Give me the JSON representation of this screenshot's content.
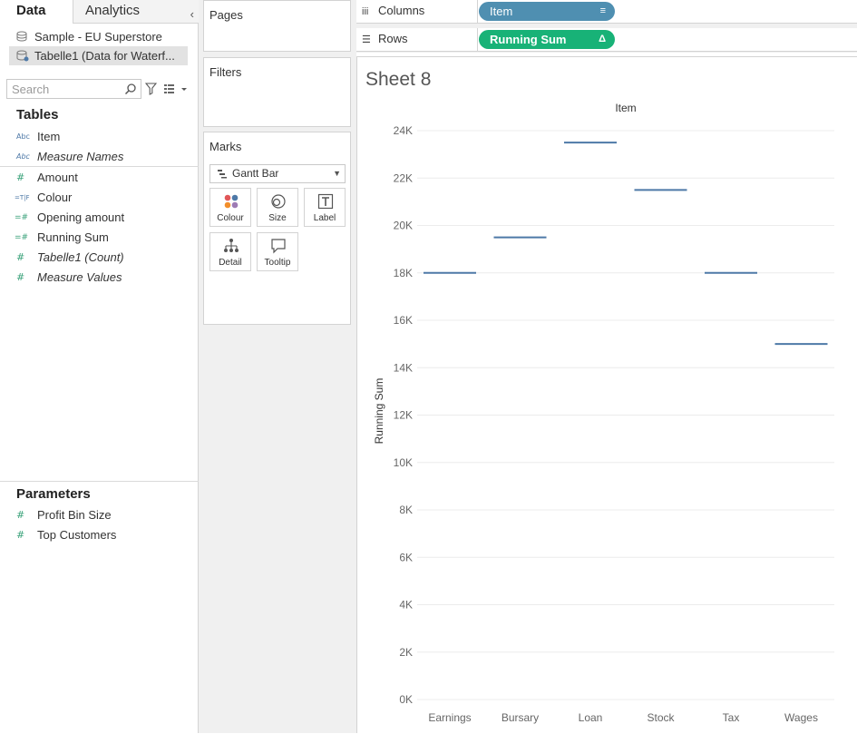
{
  "tabs": {
    "data_label": "Data",
    "analytics_label": "Analytics"
  },
  "data_sources": [
    {
      "label": "Sample - EU Superstore",
      "selected": false
    },
    {
      "label": "Tabelle1 (Data for Waterf...",
      "selected": true
    }
  ],
  "search": {
    "placeholder": "Search"
  },
  "tables_title": "Tables",
  "fields": [
    {
      "label": "Item",
      "icon": "Abc",
      "type": "dimension-string",
      "italic": false
    },
    {
      "label": "Measure Names",
      "icon": "Abc",
      "type": "dimension-string",
      "italic": true
    },
    {
      "label": "Amount",
      "icon": "#",
      "type": "measure",
      "italic": false
    },
    {
      "label": "Colour",
      "icon": "=T|F",
      "type": "calculated-boolean",
      "italic": false
    },
    {
      "label": "Opening amount",
      "icon": "=#",
      "type": "calculated-measure",
      "italic": false
    },
    {
      "label": "Running Sum",
      "icon": "=#",
      "type": "calculated-measure",
      "italic": false
    },
    {
      "label": "Tabelle1 (Count)",
      "icon": "#",
      "type": "measure",
      "italic": true
    },
    {
      "label": "Measure Values",
      "icon": "#",
      "type": "measure",
      "italic": true
    }
  ],
  "parameters_title": "Parameters",
  "parameters": [
    {
      "label": "Profit Bin Size",
      "icon": "#"
    },
    {
      "label": "Top Customers",
      "icon": "#"
    }
  ],
  "cards": {
    "pages": "Pages",
    "filters": "Filters",
    "marks": "Marks"
  },
  "marks": {
    "type": "Gantt Bar",
    "buttons": [
      "Colour",
      "Size",
      "Label",
      "Detail",
      "Tooltip"
    ]
  },
  "shelves": {
    "columns_label": "Columns",
    "columns_pill": "Item",
    "rows_label": "Rows",
    "rows_pill": "Running Sum",
    "rows_pill_icon": "Δ"
  },
  "sheet_title": "Sheet 8",
  "colors": {
    "mark": "#4e79a7",
    "rows_pill": "#18b277",
    "columns_pill": "#4f8fb1"
  },
  "chart_data": {
    "type": "gantt",
    "title": "",
    "column_header": "Item",
    "categories": [
      "Earnings",
      "Bursary",
      "Loan",
      "Stock",
      "Tax",
      "Wages"
    ],
    "values": [
      18000,
      19500,
      23500,
      21500,
      18000,
      15000
    ],
    "ylabel": "Running Sum",
    "ylim": [
      0,
      24000
    ],
    "yticks": [
      0,
      2000,
      4000,
      6000,
      8000,
      10000,
      12000,
      14000,
      16000,
      18000,
      20000,
      22000,
      24000
    ],
    "ytick_labels": [
      "0K",
      "2K",
      "4K",
      "6K",
      "8K",
      "10K",
      "12K",
      "14K",
      "16K",
      "18K",
      "20K",
      "22K",
      "24K"
    ],
    "grid": true
  }
}
